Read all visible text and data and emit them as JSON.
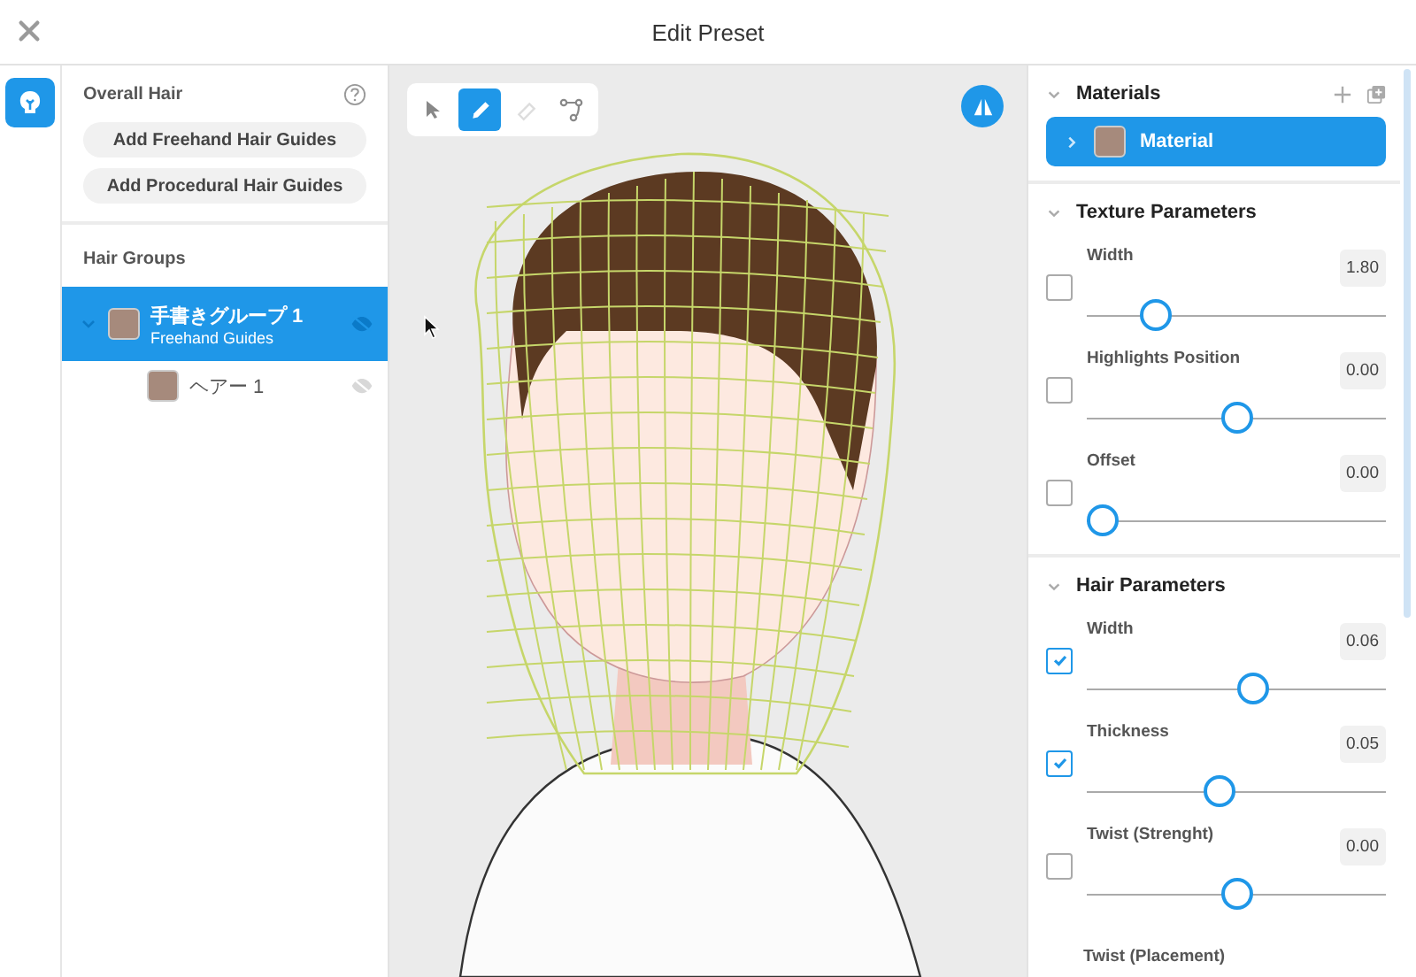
{
  "window": {
    "title": "Edit Preset"
  },
  "left_panel": {
    "overall_hair": {
      "title": "Overall Hair",
      "buttons": [
        "Add Freehand Hair Guides",
        "Add Procedural Hair Guides"
      ]
    },
    "hair_groups": {
      "title": "Hair Groups",
      "items": [
        {
          "name": "手書きグループ 1",
          "subtitle": "Freehand Guides",
          "color": "#a68a7c",
          "selected": true,
          "expanded": true,
          "children": [
            {
              "name": "ヘアー 1",
              "color": "#a68a7c",
              "selected": false
            }
          ]
        }
      ]
    }
  },
  "viewport": {
    "tools": [
      {
        "kind": "select",
        "selected": false,
        "disabled": false
      },
      {
        "kind": "pen",
        "selected": true,
        "disabled": false
      },
      {
        "kind": "eraser",
        "selected": false,
        "disabled": true
      },
      {
        "kind": "path",
        "selected": false,
        "disabled": false
      }
    ]
  },
  "right_panel": {
    "materials": {
      "title": "Materials",
      "items": [
        {
          "name": "Material",
          "color": "#a68a7c",
          "selected": true
        }
      ]
    },
    "sections": [
      {
        "title": "Texture Parameters",
        "params": [
          {
            "label": "Width",
            "value": "1.80",
            "checked": false,
            "level": 0.2
          },
          {
            "label": "Highlights Position",
            "value": "0.00",
            "checked": false,
            "level": 0.5
          },
          {
            "label": "Offset",
            "value": "0.00",
            "checked": false,
            "level": 0
          }
        ]
      },
      {
        "title": "Hair Parameters",
        "params": [
          {
            "label": "Width",
            "value": "0.06",
            "checked": true,
            "level": 0.56
          },
          {
            "label": "Thickness",
            "value": "0.05",
            "checked": true,
            "level": 0.44
          },
          {
            "label": "Twist (Strenght)",
            "value": "0.00",
            "checked": false,
            "level": 0.5
          },
          {
            "label": "Twist (Placement)"
          }
        ]
      }
    ]
  }
}
